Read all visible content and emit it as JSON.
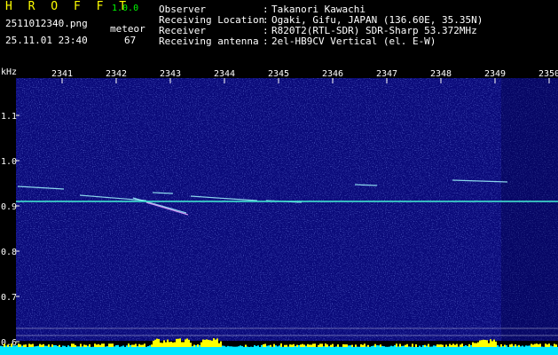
{
  "header": {
    "app_name": "H R O F F T",
    "app_version": "1.0.0",
    "file_name": "2511012340.png",
    "datetime": "25.11.01 23:40",
    "meteor_label": "meteor",
    "meteor_count": "67",
    "meta": [
      {
        "label": "Observer",
        "value": "Takanori Kawachi"
      },
      {
        "label": "Receiving Location",
        "value": "Ogaki, Gifu, JAPAN (136.60E, 35.35N)"
      },
      {
        "label": "Receiver",
        "value": "R820T2(RTL-SDR) SDR-Sharp 53.372MHz"
      },
      {
        "label": "Receiving antenna",
        "value": "2el-HB9CV Vertical (el. E-W)"
      }
    ]
  },
  "spectrogram": {
    "unit_label": "kHz",
    "time_ticks": [
      "2341",
      "2342",
      "2343",
      "2344",
      "2345",
      "2346",
      "2347",
      "2348",
      "2349",
      "2350"
    ],
    "freq_ticks": [
      "1.1",
      "1.0",
      "0.9",
      "0.8",
      "0.7",
      "0.6"
    ],
    "carrier_khz": 0.91,
    "colors": {
      "background": "#0a0a7a",
      "carrier": "#40e0d0",
      "trace": "#9ff7ff",
      "meteor_head": "#e0a0ff",
      "activity_bar": "#00e5ff",
      "activity_peak": "#ffff00",
      "grid_line": "#ffffff"
    }
  }
}
